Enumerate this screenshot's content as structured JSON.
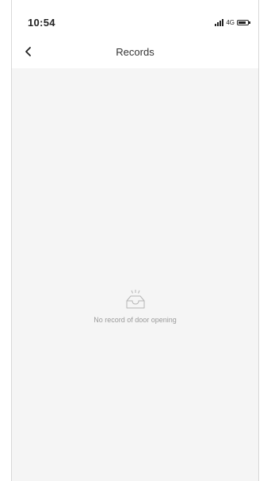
{
  "status_bar": {
    "time": "10:54",
    "network": "4G",
    "signal_icon": "signal-bars-icon",
    "battery_icon": "battery-icon"
  },
  "nav": {
    "title": "Records",
    "back_icon": "chevron-left-icon"
  },
  "empty_state": {
    "icon": "empty-inbox-icon",
    "message": "No record of door opening"
  },
  "colors": {
    "page_background": "#f5f5f5",
    "bar_background": "#ffffff",
    "title_text": "#333333",
    "muted_text": "#9a9a9a"
  }
}
